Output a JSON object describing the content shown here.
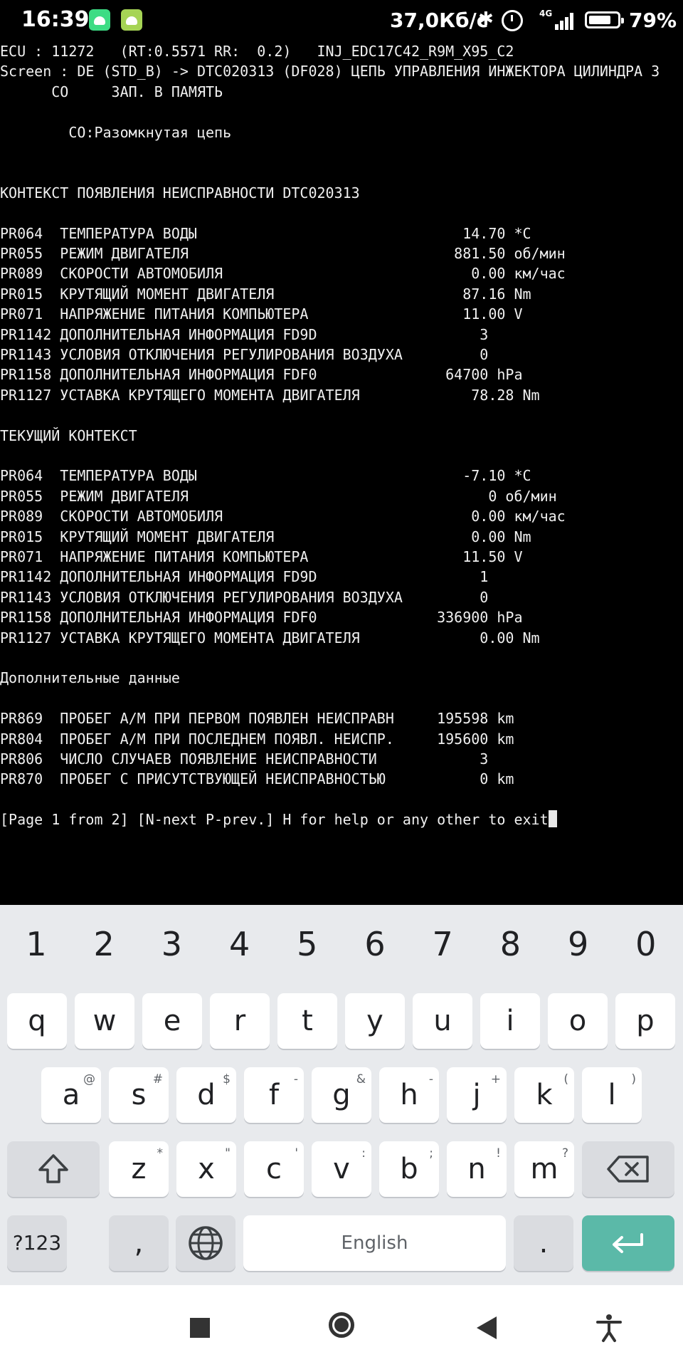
{
  "status_bar": {
    "time": "16:39",
    "net_speed": "37,0Кб/с",
    "network": "4G",
    "battery": "79%"
  },
  "terminal": {
    "lines": [
      "ECU : 11272   (RT:0.5571 RR:  0.2)   INJ_EDC17C42_R9M_X95_C2",
      "Screen : DE (STD_B) -> DTC020313 (DF028) ЦЕПЬ УПРАВЛЕНИЯ ИНЖЕКТОРА ЦИЛИНДРА 3",
      "      CO     ЗАП. В ПАМЯТЬ",
      "",
      "        CO:Разомкнутая цепь",
      "",
      "",
      "КОНТЕКСТ ПОЯВЛЕНИЯ НЕИСПРАВНОСТИ DTC020313",
      "",
      "PR064  ТЕМПЕРАТУРА ВОДЫ                               14.70 *C",
      "PR055  РЕЖИМ ДВИГАТЕЛЯ                               881.50 об/мин",
      "PR089  СКОРОСТИ АВТОМОБИЛЯ                             0.00 км/час",
      "PR015  КРУТЯЩИЙ МОМЕНТ ДВИГАТЕЛЯ                      87.16 Nm",
      "PR071  НАПРЯЖЕНИЕ ПИТАНИЯ КОМПЬЮТЕРА                  11.00 V",
      "PR1142 ДОПОЛНИТЕЛЬНАЯ ИНФОРМАЦИЯ FD9D                   3",
      "PR1143 УСЛОВИЯ ОТКЛЮЧЕНИЯ РЕГУЛИРОВАНИЯ ВОЗДУХА         0",
      "PR1158 ДОПОЛНИТЕЛЬНАЯ ИНФОРМАЦИЯ FDF0               64700 hPa",
      "PR1127 УСТАВКА КРУТЯЩЕГО МОМЕНТА ДВИГАТЕЛЯ             78.28 Nm",
      "",
      "ТЕКУЩИЙ КОНТЕКСТ",
      "",
      "PR064  ТЕМПЕРАТУРА ВОДЫ                               -7.10 *C",
      "PR055  РЕЖИМ ДВИГАТЕЛЯ                                   0 об/мин",
      "PR089  СКОРОСТИ АВТОМОБИЛЯ                             0.00 км/час",
      "PR015  КРУТЯЩИЙ МОМЕНТ ДВИГАТЕЛЯ                       0.00 Nm",
      "PR071  НАПРЯЖЕНИЕ ПИТАНИЯ КОМПЬЮТЕРА                  11.50 V",
      "PR1142 ДОПОЛНИТЕЛЬНАЯ ИНФОРМАЦИЯ FD9D                   1",
      "PR1143 УСЛОВИЯ ОТКЛЮЧЕНИЯ РЕГУЛИРОВАНИЯ ВОЗДУХА         0",
      "PR1158 ДОПОЛНИТЕЛЬНАЯ ИНФОРМАЦИЯ FDF0              336900 hPa",
      "PR1127 УСТАВКА КРУТЯЩЕГО МОМЕНТА ДВИГАТЕЛЯ              0.00 Nm",
      "",
      "Дополнительные данные",
      "",
      "PR869  ПРОБЕГ А/М ПРИ ПЕРВОМ ПОЯВЛЕН НЕИСПРАВН     195598 km",
      "PR804  ПРОБЕГ А/М ПРИ ПОСЛЕДНЕМ ПОЯВЛ. НЕИСПР.     195600 km",
      "PR806  ЧИСЛО СЛУЧАЕВ ПОЯВЛЕНИЕ НЕИСПРАВНОСТИ            3",
      "PR870  ПРОБЕГ С ПРИСУТСТВУЮЩЕЙ НЕИСПРАВНОСТЬЮ           0 km",
      "",
      "[Page 1 from 2] [N-next P-prev.] H for help or any other to exit"
    ]
  },
  "keyboard": {
    "numbers": [
      "1",
      "2",
      "3",
      "4",
      "5",
      "6",
      "7",
      "8",
      "9",
      "0"
    ],
    "row1": [
      {
        "k": "q"
      },
      {
        "k": "w"
      },
      {
        "k": "e"
      },
      {
        "k": "r"
      },
      {
        "k": "t"
      },
      {
        "k": "y"
      },
      {
        "k": "u"
      },
      {
        "k": "i"
      },
      {
        "k": "o"
      },
      {
        "k": "p"
      }
    ],
    "row2": [
      {
        "k": "a",
        "h": "@"
      },
      {
        "k": "s",
        "h": "#"
      },
      {
        "k": "d",
        "h": "$"
      },
      {
        "k": "f",
        "h": "-"
      },
      {
        "k": "g",
        "h": "&"
      },
      {
        "k": "h",
        "h": "-"
      },
      {
        "k": "j",
        "h": "+"
      },
      {
        "k": "k",
        "h": "("
      },
      {
        "k": "l",
        "h": ")"
      }
    ],
    "row3": [
      {
        "k": "z",
        "h": "*"
      },
      {
        "k": "x",
        "h": "\""
      },
      {
        "k": "c",
        "h": "'"
      },
      {
        "k": "v",
        "h": ":"
      },
      {
        "k": "b",
        "h": ";"
      },
      {
        "k": "n",
        "h": "!"
      },
      {
        "k": "m",
        "h": "?"
      }
    ],
    "symbols_label": "?123",
    "comma_label": ",",
    "space_label": "English",
    "period_label": "."
  },
  "colors": {
    "terminal_bg": "#000000",
    "terminal_fg": "#f0f0f0",
    "keyboard_bg": "#e8eaed",
    "enter_key": "#5bb9a8"
  }
}
